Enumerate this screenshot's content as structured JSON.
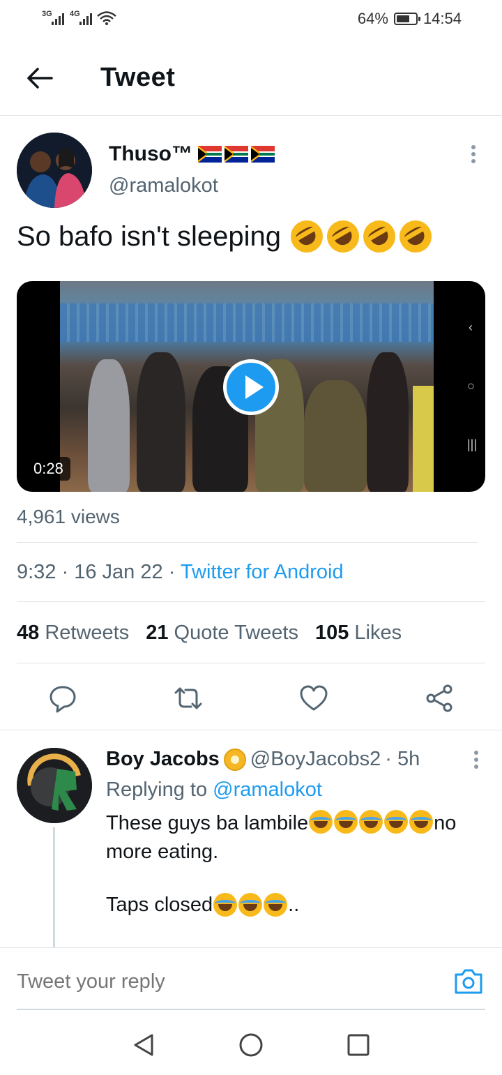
{
  "status_bar": {
    "network1": "3G",
    "network2": "4G",
    "battery_percent": "64%",
    "time": "14:54"
  },
  "header": {
    "title": "Tweet",
    "back_icon": "arrow-left-icon"
  },
  "tweet": {
    "author_name": "Thuso™",
    "author_handle": "@ramalokot",
    "text": "So bafo isn't sleeping",
    "emoji": [
      "rolling-on-floor-laughing",
      "rolling-on-floor-laughing",
      "rolling-on-floor-laughing",
      "rolling-on-floor-laughing"
    ],
    "video_duration": "0:28",
    "views": "4,961 views",
    "time": "9:32",
    "date": "16 Jan 22",
    "source": "Twitter for Android",
    "retweets_count": "48",
    "retweets_label": "Retweets",
    "quotes_count": "21",
    "quotes_label": "Quote Tweets",
    "likes_count": "105",
    "likes_label": "Likes"
  },
  "actions": [
    "reply-icon",
    "retweet-icon",
    "like-icon",
    "share-icon"
  ],
  "reply": {
    "name": "Boy Jacobs",
    "handle": "@BoyJacobs2",
    "time": "· 5h",
    "replying_prefix": "Replying to",
    "replying_to": "@ramalokot",
    "text_part1": "These guys ba lambile",
    "text_part2": "no more eating.",
    "text_line2": "Taps closed",
    "text_line2_suffix": ".."
  },
  "reply_bar": {
    "placeholder": "Tweet your reply"
  },
  "colors": {
    "accent": "#1d9bf0",
    "secondary_text": "#536471",
    "primary_text": "#0f1419"
  }
}
